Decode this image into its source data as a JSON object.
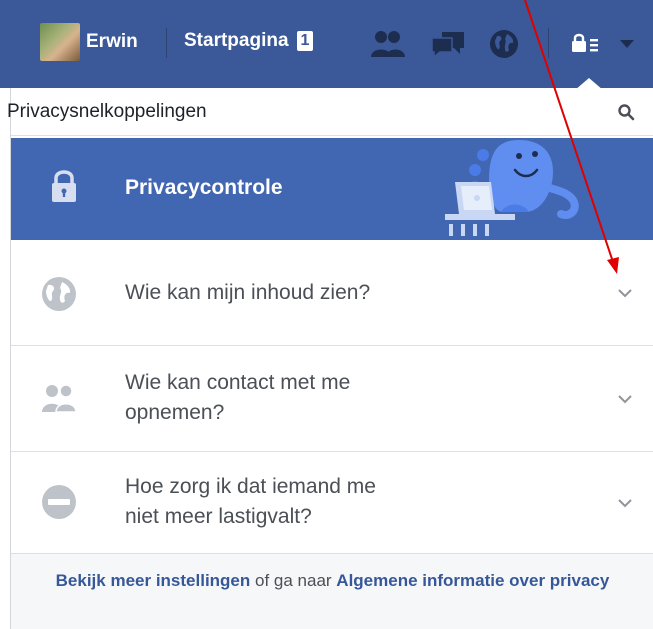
{
  "topbar": {
    "user_name": "Erwin",
    "home_label": "Startpagina",
    "home_count": "1",
    "icons": [
      "friend-requests-icon",
      "messages-icon",
      "notifications-globe-icon",
      "privacy-lock-icon",
      "account-menu-caret-icon"
    ],
    "background_color": "#3b5998"
  },
  "panel": {
    "title": "Privacysnelkoppelingen",
    "banner_label": "Privacycontrole",
    "banner_color": "#4267b2",
    "items": [
      {
        "icon": "globe-icon",
        "label_line1": "Wie kan mijn inhoud zien?",
        "label_line2": ""
      },
      {
        "icon": "people-icon",
        "label_line1": "Wie kan contact met me",
        "label_line2": "opnemen?"
      },
      {
        "icon": "block-icon",
        "label_line1": "Hoe zorg ik dat iemand me",
        "label_line2": "niet meer lastigvalt?"
      }
    ],
    "footer": {
      "link1": "Bekijk meer instellingen",
      "middle": " of ga naar ",
      "link2": "Algemene informatie over privacy"
    }
  },
  "annotation": {
    "arrow_color": "#e00000"
  }
}
